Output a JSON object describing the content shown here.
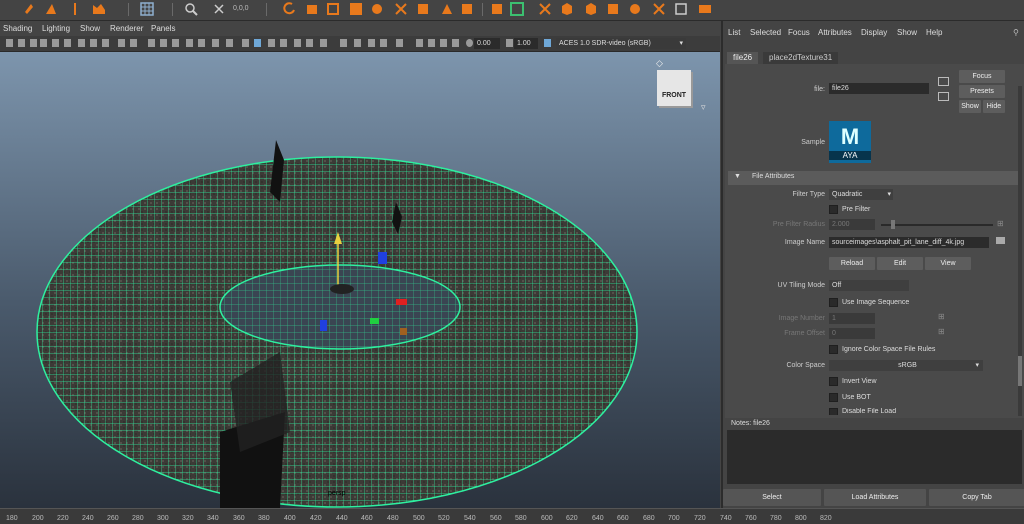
{
  "top_toolbar": {
    "coord_label": "0,0,0"
  },
  "viewport_menu": [
    "Shading",
    "Lighting",
    "Show",
    "Renderer",
    "Panels"
  ],
  "viewport_toolbar": {
    "exposure": "0.00",
    "gamma": "1.00",
    "color_space": "ACES 1.0 SDR-video (sRGB)"
  },
  "viewport": {
    "view_cube_label": "FRONT",
    "camera_label": "persp"
  },
  "ruler": [
    "180",
    "200",
    "220",
    "240",
    "260",
    "280",
    "300",
    "320",
    "340",
    "360",
    "380",
    "400",
    "420",
    "440",
    "460",
    "480",
    "500",
    "520",
    "540",
    "560",
    "580",
    "600",
    "620",
    "640",
    "660",
    "680",
    "700",
    "720",
    "740",
    "760",
    "780",
    "800",
    "820"
  ],
  "attr_editor": {
    "menu": [
      "List",
      "Selected",
      "Focus",
      "Attributes",
      "Display",
      "Show",
      "Help"
    ],
    "tabs": [
      "file26",
      "place2dTexture31"
    ],
    "node_label": "file:",
    "node_value": "file26",
    "focus_btn": "Focus",
    "presets_btn": "Presets",
    "show_btn": "Show",
    "hide_btn": "Hide",
    "sample_label": "Sample",
    "sample_logo_letter": "M",
    "sample_logo_text": "AYA",
    "section_title": "File Attributes",
    "filter_type_label": "Filter Type",
    "filter_type_value": "Quadratic",
    "pre_filter_label": "Pre Filter",
    "pre_filter_radius_label": "Pre Filter Radius",
    "pre_filter_radius_value": "2.000",
    "image_name_label": "Image Name",
    "image_name_value": "sourceimages\\asphalt_pit_lane_diff_4k.jpg",
    "reload_btn": "Reload",
    "edit_btn": "Edit",
    "view_btn": "View",
    "uv_tiling_label": "UV Tiling Mode",
    "uv_tiling_value": "Off",
    "use_image_seq_label": "Use Image Sequence",
    "image_number_label": "Image Number",
    "image_number_value": "1",
    "frame_offset_label": "Frame Offset",
    "frame_offset_value": "0",
    "ignore_cs_label": "Ignore Color Space File Rules",
    "color_space_label": "Color Space",
    "color_space_value": "sRGB",
    "invert_view_label": "Invert View",
    "use_bot_label": "Use BOT",
    "disable_file_load_label": "Disable File Load",
    "notes_label": "Notes:  file26",
    "select_btn": "Select",
    "load_attrs_btn": "Load Attributes",
    "copy_tab_btn": "Copy Tab"
  },
  "colors": {
    "wire": "#2ef0a0",
    "accent": "#e8791c",
    "maya_logo": "#0e6a9c"
  }
}
